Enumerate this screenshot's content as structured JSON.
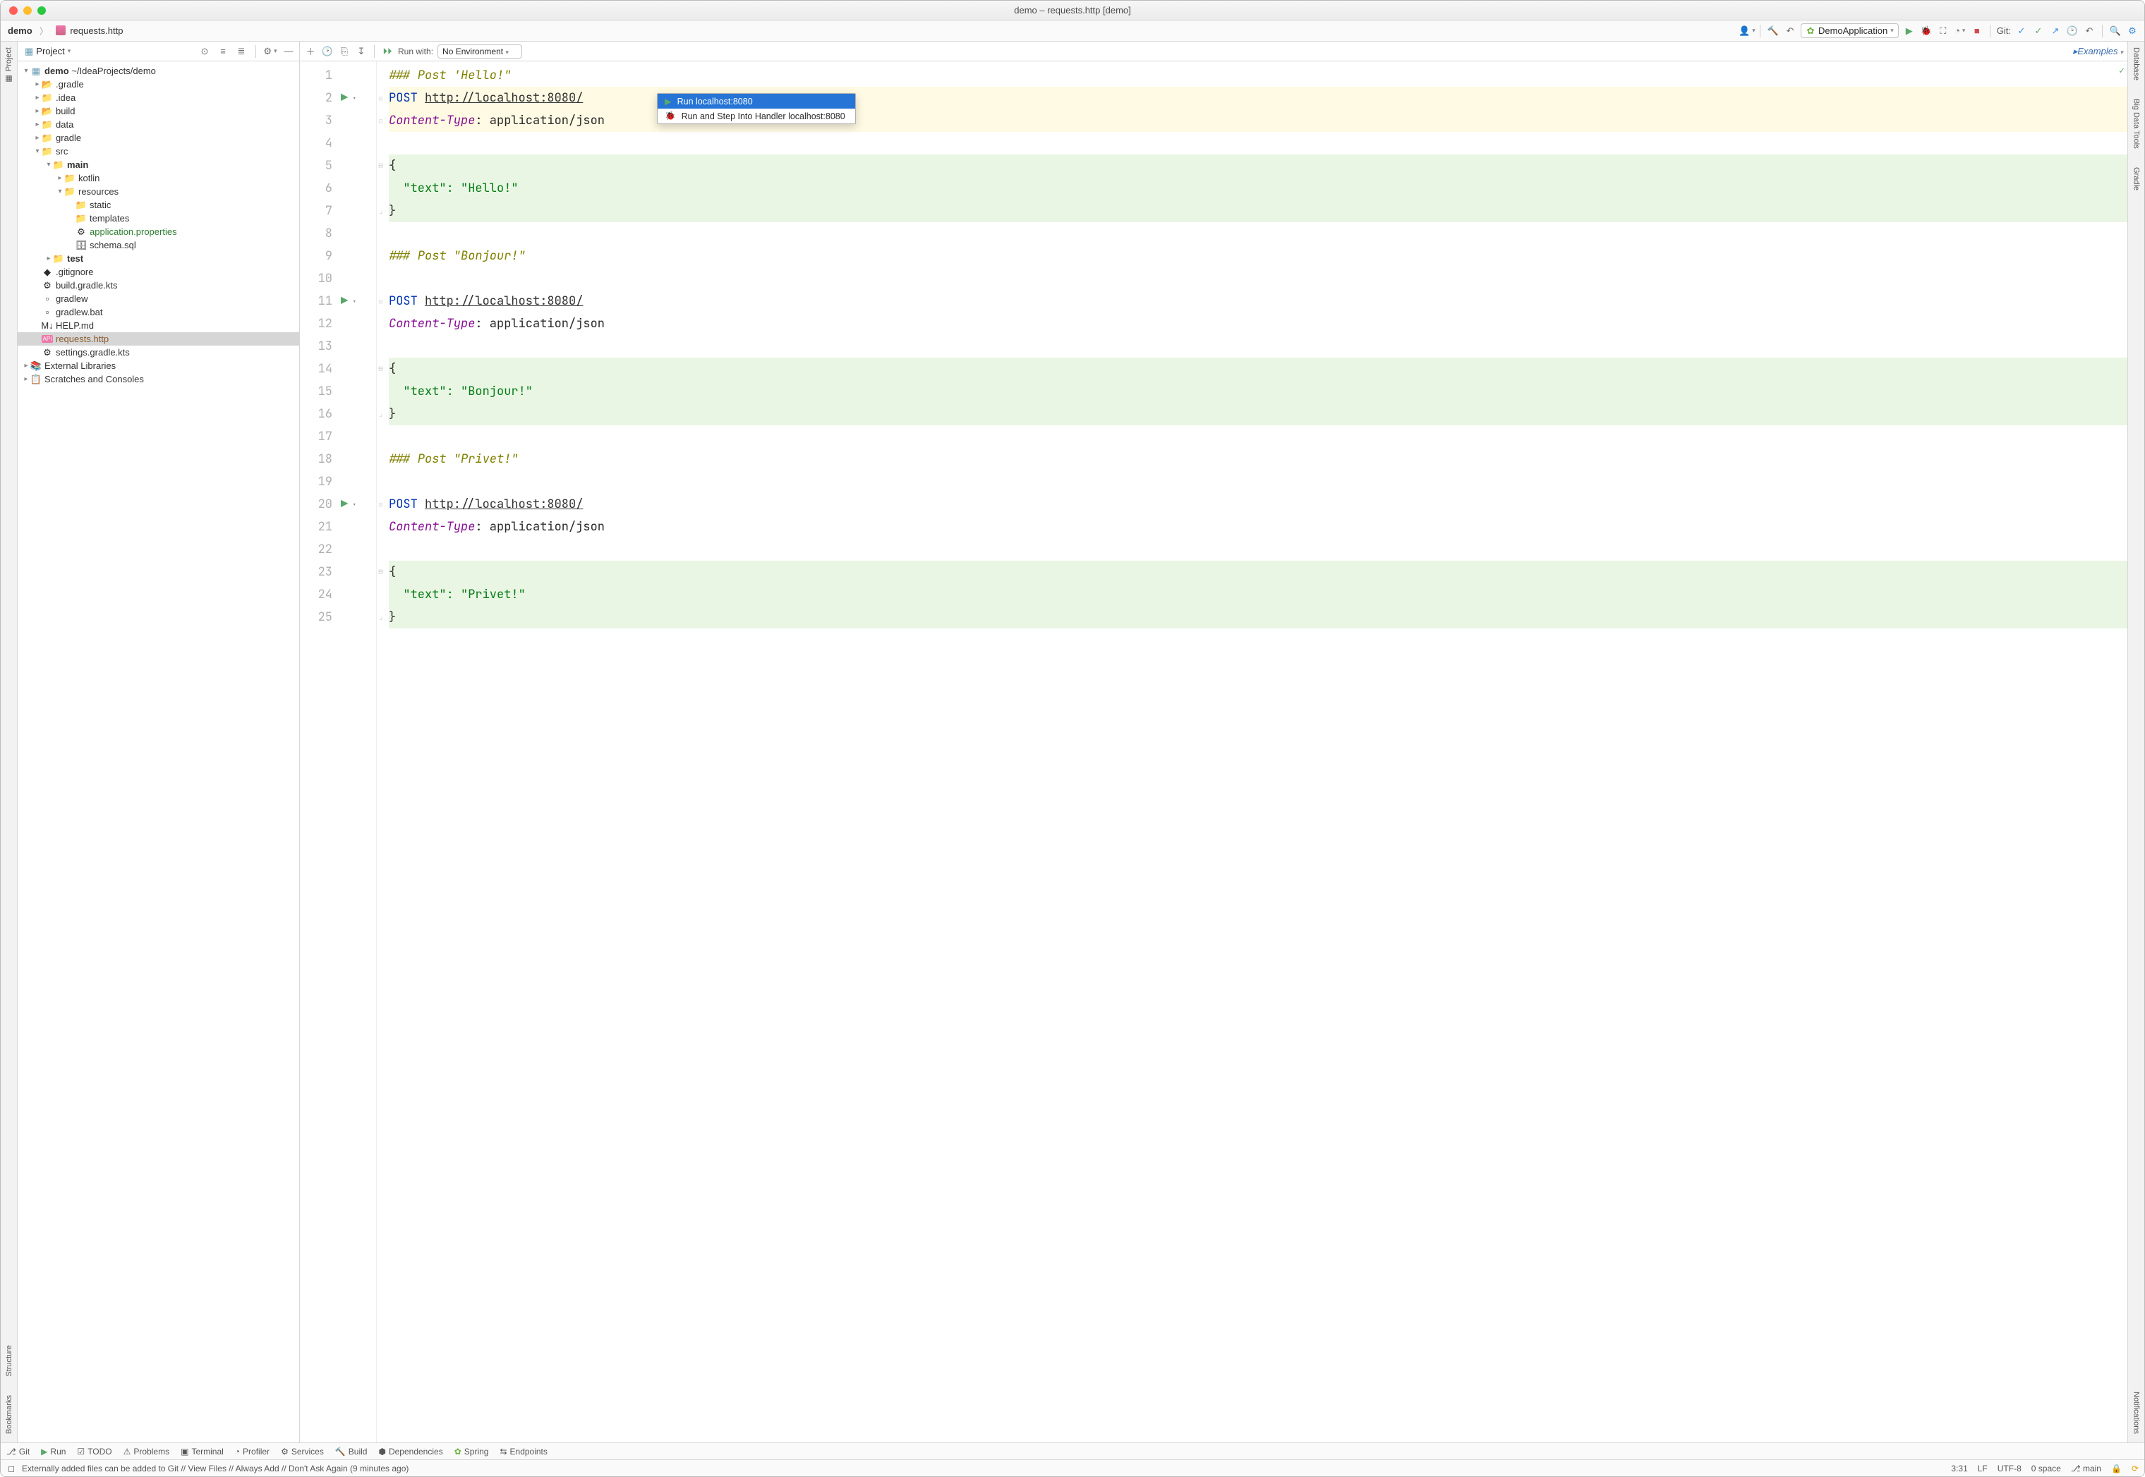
{
  "window_title": "demo – requests.http [demo]",
  "breadcrumbs": {
    "project": "demo",
    "file": "requests.http"
  },
  "toolbar_right": {
    "run_config": "DemoApplication",
    "git_label": "Git:"
  },
  "left_rail": {
    "project": "Project",
    "structure": "Structure",
    "bookmarks": "Bookmarks"
  },
  "right_rail": {
    "database": "Database",
    "bigdata": "Big Data Tools",
    "gradle": "Gradle",
    "notifications": "Notifications"
  },
  "sidebar": {
    "title": "Project",
    "root": {
      "name": "demo",
      "path": "~/IdeaProjects/demo"
    },
    "tree": [
      {
        "d": 1,
        "exp": ">",
        "ic": "folder-o",
        "label": ".gradle"
      },
      {
        "d": 1,
        "exp": ">",
        "ic": "folder",
        "label": ".idea"
      },
      {
        "d": 1,
        "exp": ">",
        "ic": "folder-b",
        "label": "build"
      },
      {
        "d": 1,
        "exp": ">",
        "ic": "folder",
        "label": "data"
      },
      {
        "d": 1,
        "exp": ">",
        "ic": "folder",
        "label": "gradle"
      },
      {
        "d": 1,
        "exp": "v",
        "ic": "folder",
        "label": "src"
      },
      {
        "d": 2,
        "exp": "v",
        "ic": "folder-blue",
        "label": "main",
        "bold": true
      },
      {
        "d": 3,
        "exp": ">",
        "ic": "folder-blue",
        "label": "kotlin"
      },
      {
        "d": 3,
        "exp": "v",
        "ic": "folder-res",
        "label": "resources"
      },
      {
        "d": 4,
        "exp": "",
        "ic": "folder",
        "label": "static"
      },
      {
        "d": 4,
        "exp": "",
        "ic": "folder",
        "label": "templates"
      },
      {
        "d": 4,
        "exp": "",
        "ic": "prop",
        "label": "application.properties",
        "green": true
      },
      {
        "d": 4,
        "exp": "",
        "ic": "sql",
        "label": "schema.sql"
      },
      {
        "d": 2,
        "exp": ">",
        "ic": "folder-green",
        "label": "test",
        "bold": true
      },
      {
        "d": 1,
        "exp": "",
        "ic": "git",
        "label": ".gitignore"
      },
      {
        "d": 1,
        "exp": "",
        "ic": "kts",
        "label": "build.gradle.kts"
      },
      {
        "d": 1,
        "exp": "",
        "ic": "file",
        "label": "gradlew"
      },
      {
        "d": 1,
        "exp": "",
        "ic": "bat",
        "label": "gradlew.bat"
      },
      {
        "d": 1,
        "exp": "",
        "ic": "md",
        "label": "HELP.md"
      },
      {
        "d": 1,
        "exp": "",
        "ic": "api",
        "label": "requests.http",
        "brown": true,
        "selected": true
      },
      {
        "d": 1,
        "exp": "",
        "ic": "kts",
        "label": "settings.gradle.kts"
      }
    ],
    "external": "External Libraries",
    "scratches": "Scratches and Consoles"
  },
  "editor_toolbar": {
    "run_with": "Run with:",
    "environment": "No Environment",
    "examples": "Examples"
  },
  "popup": {
    "run": "Run localhost:8080",
    "debug": "Run and Step Into Handler localhost:8080"
  },
  "code": [
    {
      "n": 1,
      "tokens": [
        {
          "c": "kw-comment",
          "t": "### Post 'Hello!\""
        }
      ]
    },
    {
      "n": 2,
      "run": true,
      "tokens": [
        {
          "c": "kw-method",
          "t": "POST "
        },
        {
          "c": "kw-url",
          "t": "http://localhost:8080/"
        }
      ],
      "hl": true
    },
    {
      "n": 3,
      "tokens": [
        {
          "c": "kw-header",
          "t": "Content-Type"
        },
        {
          "c": "",
          "t": ": application/json"
        }
      ],
      "hl": true
    },
    {
      "n": 4,
      "tokens": []
    },
    {
      "n": 5,
      "tokens": [
        {
          "c": "kw-brace",
          "t": "{"
        }
      ],
      "gr": true,
      "fold": "open"
    },
    {
      "n": 6,
      "tokens": [
        {
          "c": "",
          "t": "  "
        },
        {
          "c": "kw-str",
          "t": "\"text\": \"Hello!\""
        }
      ],
      "gr": true
    },
    {
      "n": 7,
      "tokens": [
        {
          "c": "kw-brace",
          "t": "}"
        }
      ],
      "gr": true,
      "fold": "close"
    },
    {
      "n": 8,
      "tokens": []
    },
    {
      "n": 9,
      "tokens": [
        {
          "c": "kw-comment",
          "t": "### Post \"Bonjour!\""
        }
      ]
    },
    {
      "n": 10,
      "tokens": []
    },
    {
      "n": 11,
      "run": true,
      "tokens": [
        {
          "c": "kw-method",
          "t": "POST "
        },
        {
          "c": "kw-url",
          "t": "http://localhost:8080/"
        }
      ]
    },
    {
      "n": 12,
      "tokens": [
        {
          "c": "kw-header",
          "t": "Content-Type"
        },
        {
          "c": "",
          "t": ": application/json"
        }
      ]
    },
    {
      "n": 13,
      "tokens": []
    },
    {
      "n": 14,
      "tokens": [
        {
          "c": "kw-brace",
          "t": "{"
        }
      ],
      "gr": true,
      "fold": "open"
    },
    {
      "n": 15,
      "tokens": [
        {
          "c": "",
          "t": "  "
        },
        {
          "c": "kw-str",
          "t": "\"text\": \"Bonjour!\""
        }
      ],
      "gr": true
    },
    {
      "n": 16,
      "tokens": [
        {
          "c": "kw-brace",
          "t": "}"
        }
      ],
      "gr": true,
      "fold": "close"
    },
    {
      "n": 17,
      "tokens": []
    },
    {
      "n": 18,
      "tokens": [
        {
          "c": "kw-comment",
          "t": "### Post \"Privet!\""
        }
      ]
    },
    {
      "n": 19,
      "tokens": []
    },
    {
      "n": 20,
      "run": true,
      "tokens": [
        {
          "c": "kw-method",
          "t": "POST "
        },
        {
          "c": "kw-url",
          "t": "http://localhost:8080/"
        }
      ]
    },
    {
      "n": 21,
      "tokens": [
        {
          "c": "kw-header",
          "t": "Content-Type"
        },
        {
          "c": "",
          "t": ": application/json"
        }
      ]
    },
    {
      "n": 22,
      "tokens": []
    },
    {
      "n": 23,
      "tokens": [
        {
          "c": "kw-brace",
          "t": "{"
        }
      ],
      "gr": true,
      "fold": "open"
    },
    {
      "n": 24,
      "tokens": [
        {
          "c": "",
          "t": "  "
        },
        {
          "c": "kw-str",
          "t": "\"text\": \"Privet!\""
        }
      ],
      "gr": true
    },
    {
      "n": 25,
      "tokens": [
        {
          "c": "kw-brace",
          "t": "}"
        }
      ],
      "gr": true,
      "fold": "close"
    }
  ],
  "bottombar": {
    "git": "Git",
    "run": "Run",
    "todo": "TODO",
    "problems": "Problems",
    "terminal": "Terminal",
    "profiler": "Profiler",
    "services": "Services",
    "build": "Build",
    "deps": "Dependencies",
    "spring": "Spring",
    "endpoints": "Endpoints"
  },
  "statusbar": {
    "message": "Externally added files can be added to Git // View Files // Always Add // Don't Ask Again (9 minutes ago)",
    "pos": "3:31",
    "le": "LF",
    "enc": "UTF-8",
    "indent": "0 space",
    "branch": "main"
  }
}
